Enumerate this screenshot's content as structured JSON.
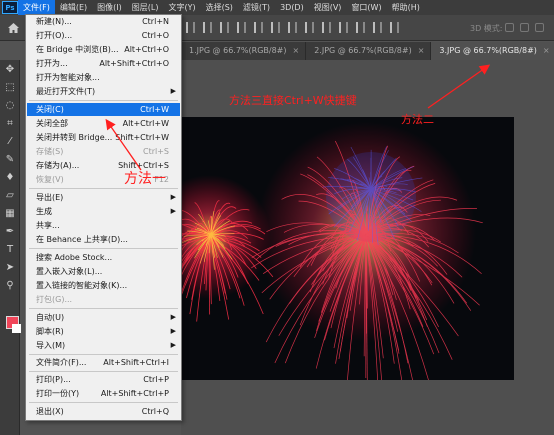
{
  "app": {
    "logo": "Ps"
  },
  "menubar": {
    "items": [
      "文件(F)",
      "编辑(E)",
      "图像(I)",
      "图层(L)",
      "文字(Y)",
      "选择(S)",
      "滤镜(T)",
      "3D(D)",
      "视图(V)",
      "窗口(W)",
      "帮助(H)"
    ]
  },
  "optionsbar": {
    "mode_label": "3D 模式:"
  },
  "tabs": [
    {
      "label": "1.JPG @ 66.7%(RGB/8#)",
      "close": "×"
    },
    {
      "label": "2.JPG @ 66.7%(RGB/8#)",
      "close": "×"
    },
    {
      "label": "3.JPG @ 66.7%(RGB/8#)",
      "close": "×"
    }
  ],
  "file_menu": {
    "items": [
      {
        "label": "新建(N)...",
        "shortcut": "Ctrl+N"
      },
      {
        "label": "打开(O)...",
        "shortcut": "Ctrl+O"
      },
      {
        "label": "在 Bridge 中浏览(B)...",
        "shortcut": "Alt+Ctrl+O"
      },
      {
        "label": "打开为...",
        "shortcut": "Alt+Shift+Ctrl+O"
      },
      {
        "label": "打开为智能对象..."
      },
      {
        "label": "最近打开文件(T)",
        "submenu": "▶"
      },
      {
        "label": "关闭(C)",
        "shortcut": "Ctrl+W"
      },
      {
        "label": "关闭全部",
        "shortcut": "Alt+Ctrl+W"
      },
      {
        "label": "关闭并转到 Bridge...",
        "shortcut": "Shift+Ctrl+W"
      },
      {
        "label": "存储(S)",
        "shortcut": "Ctrl+S"
      },
      {
        "label": "存储为(A)...",
        "shortcut": "Shift+Ctrl+S"
      },
      {
        "label": "恢复(V)",
        "shortcut": "F12"
      },
      {
        "label": "导出(E)",
        "submenu": "▶"
      },
      {
        "label": "生成",
        "submenu": "▶"
      },
      {
        "label": "共享..."
      },
      {
        "label": "在 Behance 上共享(D)..."
      },
      {
        "label": "搜索 Adobe Stock..."
      },
      {
        "label": "置入嵌入对象(L)..."
      },
      {
        "label": "置入链接的智能对象(K)..."
      },
      {
        "label": "打包(G)..."
      },
      {
        "label": "自动(U)",
        "submenu": "▶"
      },
      {
        "label": "脚本(R)",
        "submenu": "▶"
      },
      {
        "label": "导入(M)",
        "submenu": "▶"
      },
      {
        "label": "文件简介(F)...",
        "shortcut": "Alt+Shift+Ctrl+I"
      },
      {
        "label": "打印(P)...",
        "shortcut": "Ctrl+P"
      },
      {
        "label": "打印一份(Y)",
        "shortcut": "Alt+Shift+Ctrl+P"
      },
      {
        "label": "退出(X)",
        "shortcut": "Ctrl+Q"
      }
    ]
  },
  "annotations": {
    "method3": "方法三直接Ctrl+W快捷键",
    "method2": "方法二",
    "method1": "方法一"
  },
  "colors": {
    "accent": "#1473e6",
    "annotation": "#ff2020",
    "foreground_swatch": "#f0465a",
    "background_swatch": "#ffffff"
  }
}
